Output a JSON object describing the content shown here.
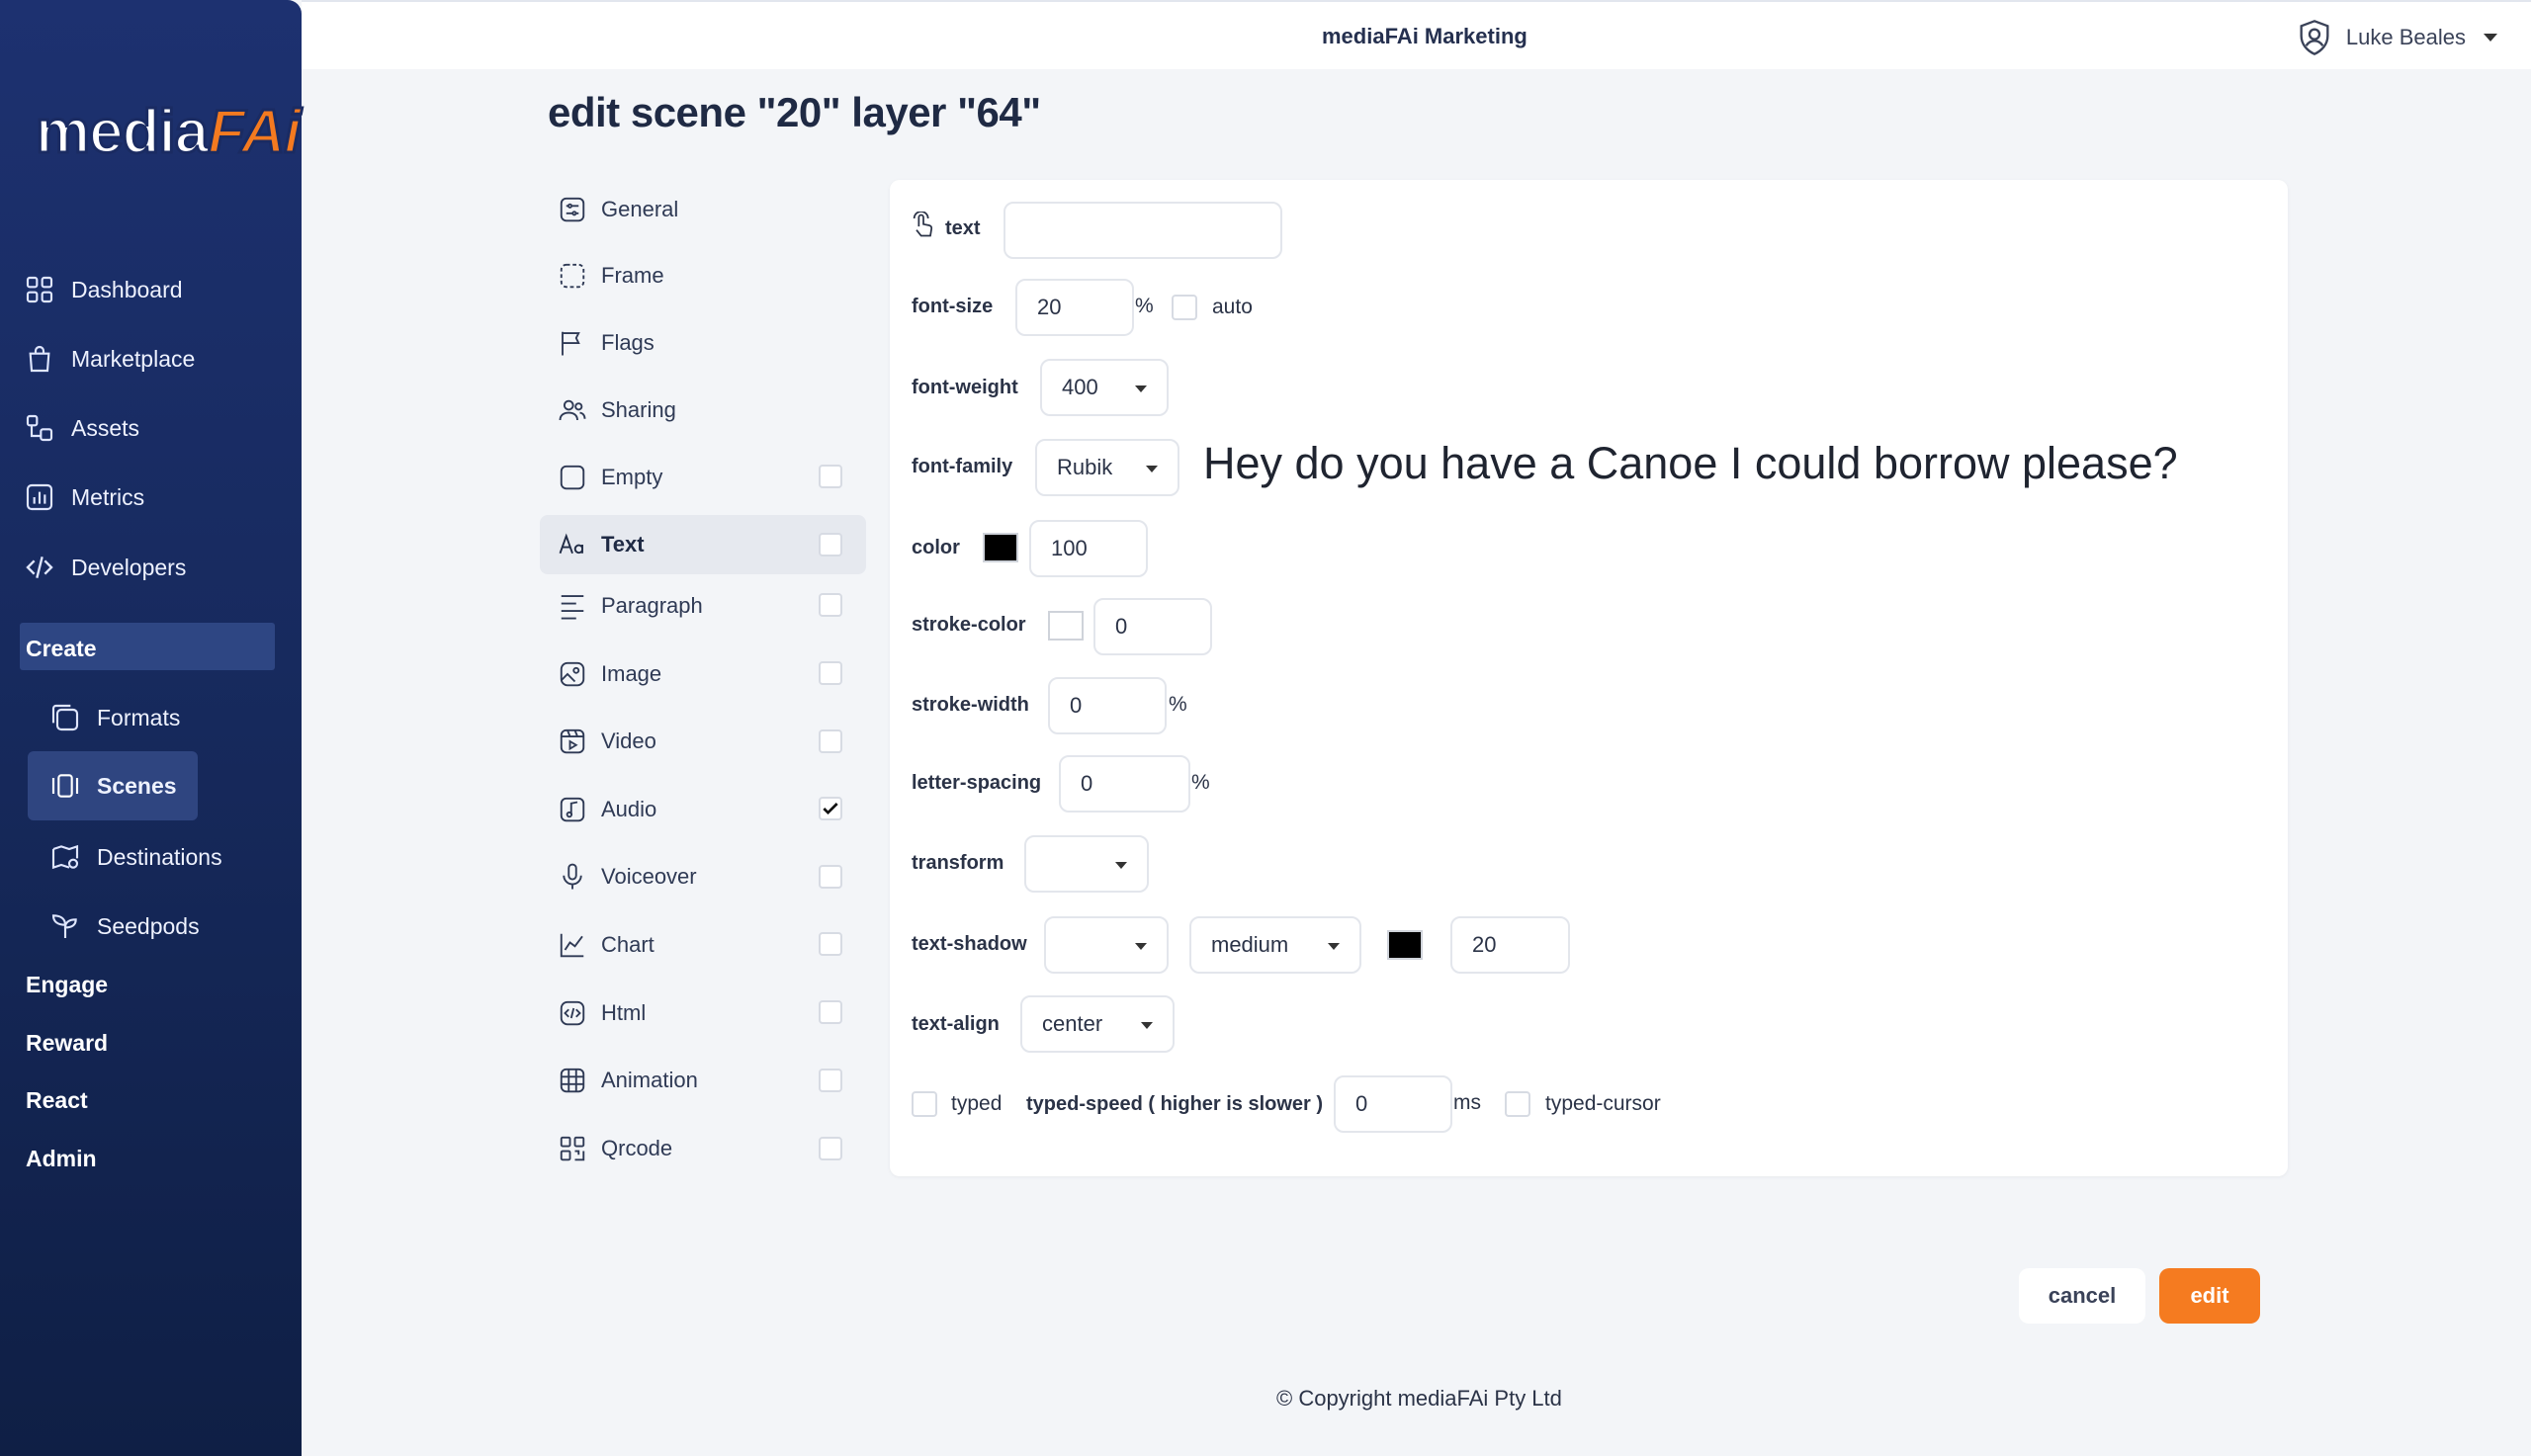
{
  "brand": {
    "logo_main": "media",
    "logo_accent": "FAi",
    "accent_color": "#f57b20",
    "sidebar_color": "#1d3170"
  },
  "header": {
    "app_title": "mediaFAi Marketing",
    "user_name": "Luke Beales"
  },
  "sidebar": {
    "items": [
      {
        "label": "Dashboard",
        "icon": "grid-icon"
      },
      {
        "label": "Marketplace",
        "icon": "shopping-bag-icon"
      },
      {
        "label": "Assets",
        "icon": "assets-icon"
      },
      {
        "label": "Metrics",
        "icon": "chart-bar-icon"
      },
      {
        "label": "Developers",
        "icon": "code-icon"
      }
    ],
    "create_label": "Create",
    "create_items": [
      {
        "label": "Formats",
        "icon": "formats-icon"
      },
      {
        "label": "Scenes",
        "icon": "scenes-icon"
      },
      {
        "label": "Destinations",
        "icon": "destinations-icon"
      },
      {
        "label": "Seedpods",
        "icon": "sprout-icon"
      }
    ],
    "sections": [
      "Engage",
      "Reward",
      "React",
      "Admin"
    ]
  },
  "page": {
    "title": "edit scene \"20\" layer \"64\""
  },
  "menu": [
    {
      "label": "General",
      "icon": "general-icon"
    },
    {
      "label": "Frame",
      "icon": "frame-icon"
    },
    {
      "label": "Flags",
      "icon": "flag-icon"
    },
    {
      "label": "Sharing",
      "icon": "users-icon"
    },
    {
      "label": "Empty",
      "icon": "square-icon",
      "checked": false
    },
    {
      "label": "Text",
      "icon": "text-icon",
      "checked": false,
      "active": true
    },
    {
      "label": "Paragraph",
      "icon": "paragraph-icon",
      "checked": false
    },
    {
      "label": "Image",
      "icon": "image-icon",
      "checked": false
    },
    {
      "label": "Video",
      "icon": "video-icon",
      "checked": false
    },
    {
      "label": "Audio",
      "icon": "audio-icon",
      "checked": true
    },
    {
      "label": "Voiceover",
      "icon": "microphone-icon",
      "checked": false
    },
    {
      "label": "Chart",
      "icon": "line-chart-icon",
      "checked": false
    },
    {
      "label": "Html",
      "icon": "html-icon",
      "checked": false
    },
    {
      "label": "Animation",
      "icon": "animation-icon",
      "checked": false
    },
    {
      "label": "Qrcode",
      "icon": "qrcode-icon",
      "checked": false
    }
  ],
  "form": {
    "text_label": "text",
    "text_value": "",
    "font_size_label": "font-size",
    "font_size_value": "20",
    "font_size_unit": "%",
    "auto_label": "auto",
    "font_weight_label": "font-weight",
    "font_weight_value": "400",
    "font_family_label": "font-family",
    "font_family_value": "Rubik",
    "preview_text": "Hey do you have a Canoe I could borrow please?",
    "color_label": "color",
    "color_swatch": "#000000",
    "color_value": "100",
    "stroke_color_label": "stroke-color",
    "stroke_color_swatch": "#ffffff",
    "stroke_color_value": "0",
    "stroke_width_label": "stroke-width",
    "stroke_width_value": "0",
    "stroke_width_unit": "%",
    "letter_spacing_label": "letter-spacing",
    "letter_spacing_value": "0",
    "letter_spacing_unit": "%",
    "transform_label": "transform",
    "transform_value": "",
    "text_shadow_label": "text-shadow",
    "text_shadow_type": "",
    "text_shadow_size": "medium",
    "text_shadow_swatch": "#000000",
    "text_shadow_value": "20",
    "text_align_label": "text-align",
    "text_align_value": "center",
    "typed_label": "typed",
    "typed_speed_label": "typed-speed ( higher is slower )",
    "typed_speed_value": "0",
    "typed_speed_unit": "ms",
    "typed_cursor_label": "typed-cursor"
  },
  "actions": {
    "cancel": "cancel",
    "edit": "edit"
  },
  "footer": {
    "copyright": "© Copyright mediaFAi Pty Ltd"
  }
}
